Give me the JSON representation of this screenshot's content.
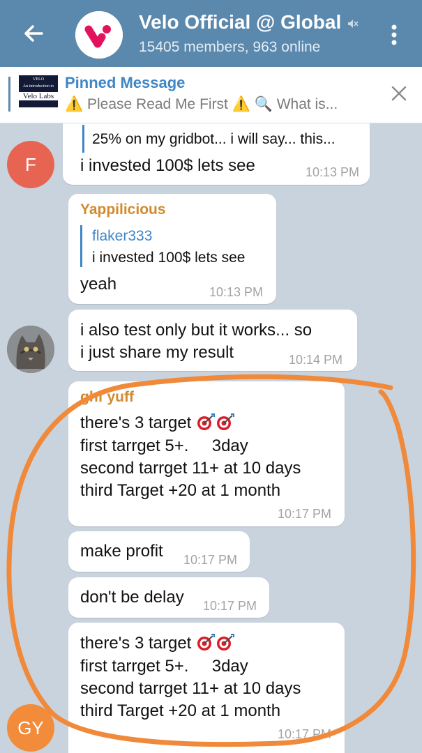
{
  "header": {
    "title": "Velo Official @ Global",
    "subtitle": "15405 members, 963 online",
    "bg_color": "#5b88ad"
  },
  "pinned": {
    "title": "Pinned Message",
    "text": "⚠️ Please Read Me First ⚠️ 🔍 What is...",
    "thumb": {
      "line1": "VELO",
      "line2": "An introduction to",
      "line3": "Velo Labs"
    }
  },
  "messages": {
    "m1": {
      "partial_text": "25% on my gridbot... i will say... this...",
      "text": "i invested 100$ lets see",
      "time": "10:13 PM",
      "avatar_letter": "F"
    },
    "m2": {
      "sender": "Yappilicious",
      "reply_name": "flaker333",
      "reply_text": "i invested 100$ lets see",
      "text": "yeah",
      "time": "10:13 PM"
    },
    "m3": {
      "line1": "i also test only but it works... so",
      "line2": "i just share my result",
      "time": "10:14 PM"
    },
    "m4": {
      "sender": "ghf yuff",
      "line1": "there's 3 target",
      "line2": "first tarrget 5+.     3day",
      "line3": "second tarrget 11+ at 10 days",
      "line4": "third Target +20 at 1 month",
      "time": "10:17 PM"
    },
    "m5": {
      "text": "make profit",
      "time": "10:17 PM"
    },
    "m6": {
      "text": "don't be delay",
      "time": "10:17 PM"
    },
    "m7": {
      "line1": "there's 3 target",
      "line2": "first tarrget 5+.     3day",
      "line3": "second tarrget 11+ at 10 days",
      "line4": "third Target +20 at 1 month",
      "time": "10:17 PM",
      "avatar_letters": "GY"
    }
  },
  "colors": {
    "accent": "#3f86c6",
    "sender_name": "#d28a2e",
    "annotation": "#f08a3a"
  }
}
